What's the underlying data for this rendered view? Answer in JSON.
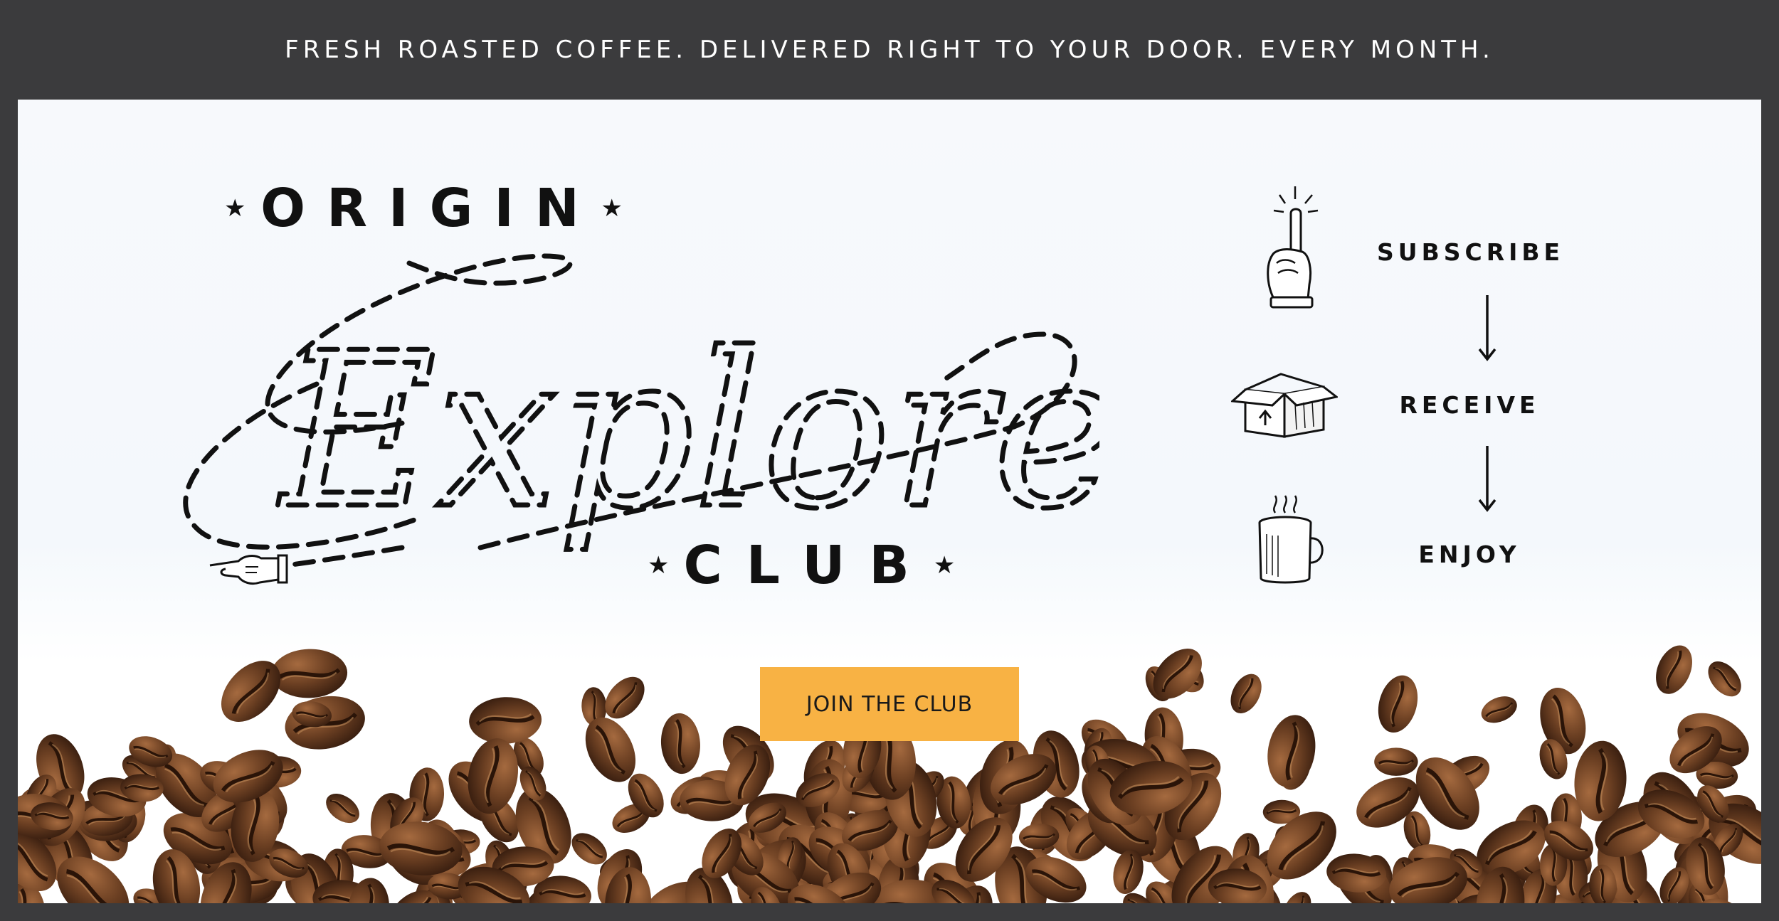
{
  "promo_bar": {
    "text": "FRESH ROASTED COFFEE. DELIVERED RIGHT TO YOUR DOOR. EVERY MONTH."
  },
  "logo": {
    "top_word": "ORIGIN",
    "script_word": "Explorers",
    "bottom_word": "CLUB",
    "star": "★"
  },
  "steps": [
    {
      "label": "SUBSCRIBE",
      "icon": "pointing-finger-icon"
    },
    {
      "label": "RECEIVE",
      "icon": "box-icon"
    },
    {
      "label": "ENJOY",
      "icon": "coffee-mug-icon"
    }
  ],
  "cta": {
    "label": "JOIN THE CLUB",
    "color": "#f8b244"
  },
  "colors": {
    "frame": "#3b3b3d",
    "text_dark": "#111111",
    "text_light": "#ffffff"
  }
}
